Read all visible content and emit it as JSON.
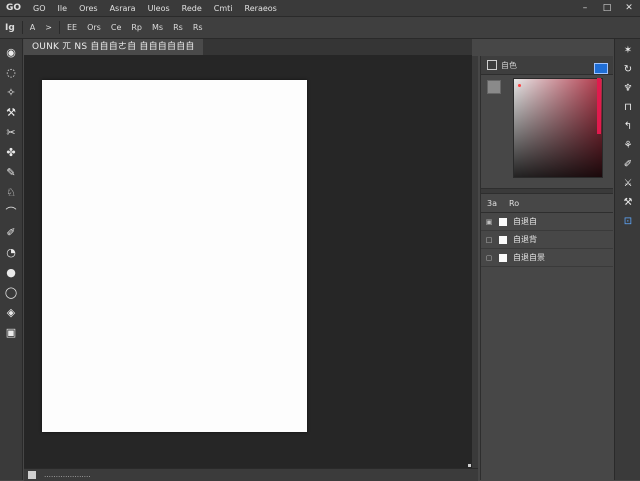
{
  "menu": {
    "logo": "GO",
    "items": [
      "GO",
      "Ile",
      "Ores",
      "Asrara",
      "Uleos",
      "Rede",
      "Cmti",
      "Reraeos"
    ]
  },
  "window_controls": [
    "–",
    "□",
    "✕"
  ],
  "options_bar": {
    "tool_label": "Ig",
    "items": [
      "A",
      ">",
      "EE",
      "Ors",
      "Ce",
      "Rp",
      "Ms",
      "Rs",
      "Rs"
    ]
  },
  "document_tab": {
    "title": "OUNK ㄫ NS 自自自ㄜ自 自自自自自自"
  },
  "left_tools": [
    "◉",
    "◌",
    "✧",
    "⚒",
    "✂",
    "✤",
    "✎",
    "♘",
    "⌒",
    "✐",
    "◔",
    "●",
    "◯",
    "◈",
    "▣"
  ],
  "status_bar": {
    "text": "‥‥‥‥‥‥‥‥‥‥"
  },
  "color_panel": {
    "label": "自色",
    "fg_color": "#8a8a8a",
    "accent_swatch": "#1f6ed6",
    "field_start": "#e7e7e7",
    "field_end": "#b13849",
    "hue": "#e11a4e"
  },
  "layers_panel": {
    "tabs": [
      "3a",
      "Ro"
    ],
    "layers": [
      {
        "eye": "▣",
        "name": "自退自"
      },
      {
        "eye": "□",
        "name": "自退背"
      },
      {
        "eye": "▢",
        "name": "自退自景"
      }
    ]
  },
  "right_tools": [
    "✶",
    "↻",
    "♆",
    "⊓",
    "↰",
    "⚘",
    "✐",
    "⚔",
    "⚒",
    "⊡"
  ]
}
